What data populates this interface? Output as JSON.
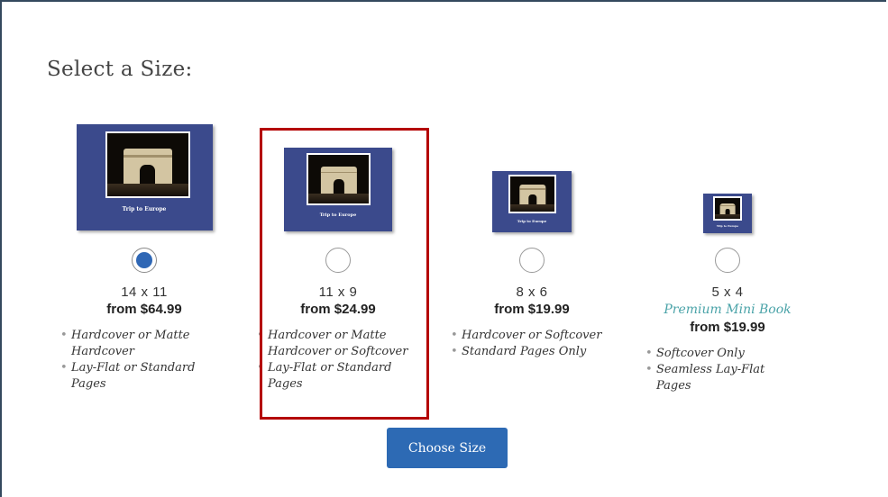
{
  "page": {
    "title": "Select a Size:"
  },
  "book_cover_text": "Trip to Europe",
  "options": [
    {
      "size": "14 x 11",
      "subtitle": "",
      "price": "from $64.99",
      "selected": true,
      "features": [
        "Hardcover or Matte Hardcover",
        "Lay-Flat or Standard Pages"
      ]
    },
    {
      "size": "11 x 9",
      "subtitle": "",
      "price": "from $24.99",
      "selected": false,
      "highlighted": true,
      "features": [
        "Hardcover or Matte Hardcover or Softcover",
        "Lay-Flat or Standard Pages"
      ]
    },
    {
      "size": "8 x 6",
      "subtitle": "",
      "price": "from $19.99",
      "selected": false,
      "features": [
        "Hardcover or Softcover",
        "Standard Pages Only"
      ]
    },
    {
      "size": "5 x 4",
      "subtitle": "Premium Mini Book",
      "price": "from $19.99",
      "selected": false,
      "features": [
        "Softcover Only",
        "Seamless Lay-Flat Pages"
      ]
    }
  ],
  "button": {
    "label": "Choose Size"
  },
  "colors": {
    "book_cover": "#3b4a8c",
    "radio_selected": "#2f67b5",
    "button": "#2d6ab4",
    "highlight": "#b40000",
    "subtitle": "#4aa3a8"
  }
}
